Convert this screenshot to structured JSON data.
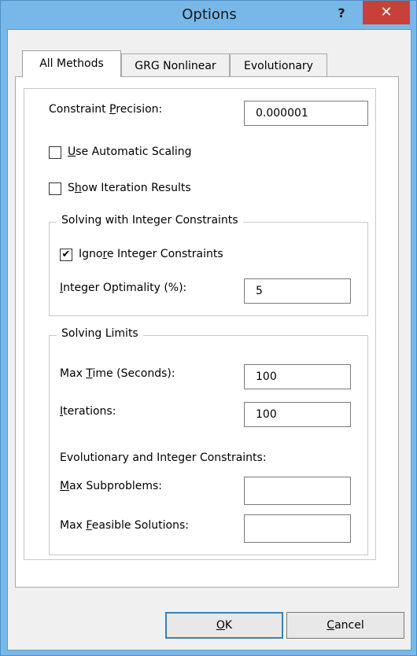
{
  "window": {
    "title": "Options",
    "help_label": "?",
    "close_label": "✕"
  },
  "tabs": [
    {
      "label": "All Methods",
      "active": true
    },
    {
      "label": "GRG Nonlinear",
      "active": false
    },
    {
      "label": "Evolutionary",
      "active": false
    }
  ],
  "constraint_precision": {
    "label_pre": "Constraint ",
    "label_acc": "P",
    "label_post": "recision:",
    "value": "0.000001"
  },
  "use_automatic_scaling": {
    "label_acc": "U",
    "label_post": "se Automatic Scaling",
    "checked": false
  },
  "show_iteration_results": {
    "label_pre": "S",
    "label_acc": "h",
    "label_post": "ow Iteration Results",
    "checked": false
  },
  "integer_group": {
    "legend": "Solving with Integer Constraints",
    "ignore": {
      "label_pre": "Igno",
      "label_acc": "r",
      "label_post": "e Integer Constraints",
      "checked": true,
      "check_mark": "✔"
    },
    "optimality": {
      "label_acc": "I",
      "label_post": "nteger Optimality (%):",
      "value": "5"
    }
  },
  "limits_group": {
    "legend": "Solving Limits",
    "max_time": {
      "label_pre": "Max ",
      "label_acc": "T",
      "label_post": "ime (Seconds):",
      "value": "100"
    },
    "iterations": {
      "label_acc": "I",
      "label_post": "terations:",
      "value": "100"
    },
    "evo_heading": "Evolutionary and Integer Constraints:",
    "max_subproblems": {
      "label_acc": "M",
      "label_post": "ax Subproblems:",
      "value": ""
    },
    "max_feasible": {
      "label_pre": "Max ",
      "label_acc": "F",
      "label_post": "easible Solutions:",
      "value": ""
    }
  },
  "buttons": {
    "ok": {
      "label_acc": "O",
      "label_post": "K"
    },
    "cancel": {
      "label_acc": "C",
      "label_post": "ancel"
    }
  }
}
